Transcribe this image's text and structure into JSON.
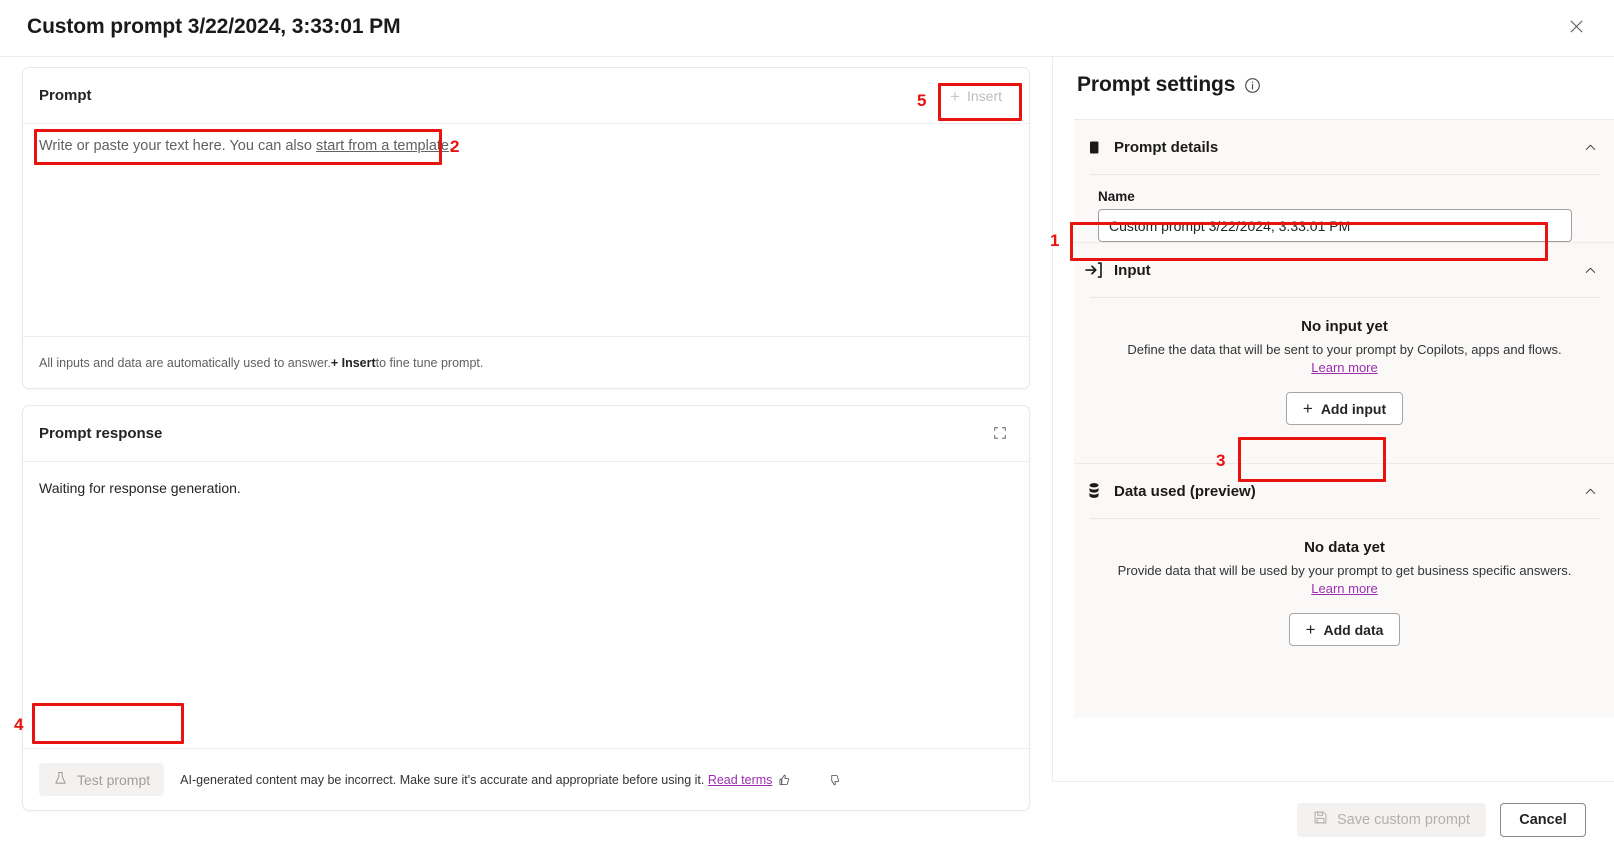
{
  "dialog": {
    "title": "Custom prompt 3/22/2024, 3:33:01 PM",
    "close_icon": "close-icon"
  },
  "prompt_card": {
    "header": "Prompt",
    "insert_button": "Insert",
    "placeholder_before": "Write or paste your text here. You can also ",
    "placeholder_link": "start from a template",
    "placeholder_after": ".",
    "footnote_before": "All inputs and data are automatically used to answer. ",
    "footnote_bold": "+ Insert",
    "footnote_after": " to fine tune prompt."
  },
  "response_card": {
    "header": "Prompt response",
    "expand_icon": "expand-icon",
    "body_text": "Waiting for response generation.",
    "test_button": "Test prompt",
    "test_icon": "flask-icon",
    "disclaimer_text": "AI-generated content may be incorrect. Make sure it's accurate and appropriate before using it. ",
    "disclaimer_link": "Read terms",
    "thumbs_up_icon": "thumbs-up-icon",
    "thumbs_down_icon": "thumbs-down-icon"
  },
  "settings": {
    "title": "Prompt settings",
    "info_icon": "info-icon",
    "details": {
      "label": "Prompt details",
      "icon": "document-icon",
      "chevron": "chevron-up-icon",
      "name_label": "Name",
      "name_value": "Custom prompt 3/22/2024, 3:33:01 PM"
    },
    "input": {
      "label": "Input",
      "icon": "arrow-into-box-icon",
      "chevron": "chevron-up-icon",
      "empty_title": "No input yet",
      "empty_desc": "Define the data that will be sent to your prompt by Copilots, apps and flows.",
      "learn_more": "Learn more",
      "add_button": "Add input"
    },
    "data_used": {
      "label": "Data used (preview)",
      "icon": "database-icon",
      "chevron": "chevron-up-icon",
      "empty_title": "No data yet",
      "empty_desc": "Provide data that will be used by your prompt to get business specific answers.",
      "learn_more": "Learn more",
      "add_button": "Add data"
    }
  },
  "footer": {
    "save_label": "Save custom prompt",
    "save_icon": "save-icon",
    "cancel_label": "Cancel"
  },
  "annotations": {
    "one": "1",
    "two": "2",
    "three": "3",
    "four": "4",
    "five": "5",
    "color": "#e8130f"
  }
}
